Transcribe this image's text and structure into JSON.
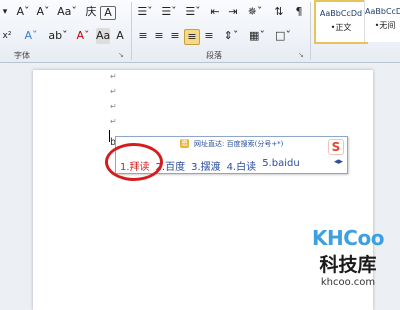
{
  "ribbon": {
    "font_group_label": "字体",
    "paragraph_group_label": "段落",
    "font_row1": [
      "Aˇ",
      "Aˇ",
      "Aaˇ",
      "庆",
      "A"
    ],
    "font_row2": [
      "x²",
      "Aˇ",
      "abˇ",
      "Aˇ",
      "Aa",
      "A"
    ],
    "para_row1": [
      "☰ˇ",
      "☰ˇ",
      "☰ˇ",
      "⇤",
      "⇥",
      "✵ˇ",
      "⇅",
      "¶"
    ],
    "para_row2": [
      "≡",
      "≡",
      "≡",
      "≡",
      "≡",
      "⇕ˇ",
      "▦ˇ",
      "□ˇ"
    ],
    "styles": [
      {
        "sample": "AaBbCcDd",
        "name": "•正文"
      },
      {
        "sample": "AaBbCcDd",
        "name": "•无间"
      }
    ]
  },
  "document": {
    "paragraph_mark": "↵",
    "typed_text": "baidu"
  },
  "ime": {
    "tip": "网址直达: 百度搜索(分号+*)",
    "tip_icon": "恩",
    "logo": "S",
    "candidates": [
      "1.拜读",
      "2.百度",
      "3.摆渡",
      "4.白读",
      "5.baidu"
    ],
    "nav": "◂▸"
  },
  "watermark": {
    "logo": "KHCoo",
    "cn": "科技库",
    "url": "khcoo.com"
  },
  "colors": {
    "ribbon_border": "#b9c4d2",
    "style_selected_border": "#e7c35a",
    "ime_text": "#2a4f9e",
    "selected_candidate": "#d21f1f",
    "highlight_ring": "#d41e1e",
    "watermark_blue": "#3fa0e0"
  }
}
